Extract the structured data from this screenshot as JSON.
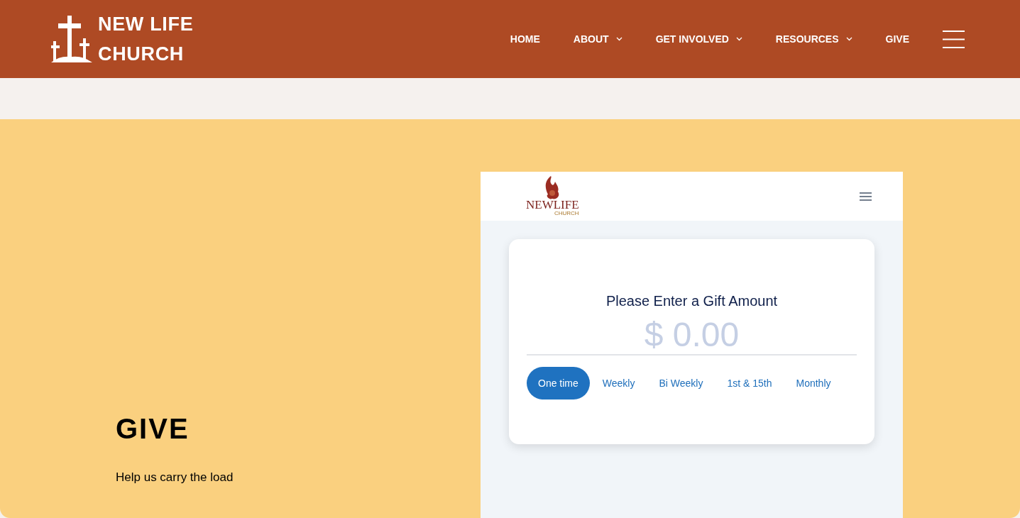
{
  "header": {
    "logo": {
      "line1": "NEW LIFE",
      "line2": "CHURCH"
    },
    "nav": [
      {
        "label": "HOME",
        "dropdown": false
      },
      {
        "label": "ABOUT",
        "dropdown": true
      },
      {
        "label": "GET INVOLVED",
        "dropdown": true
      },
      {
        "label": "RESOURCES",
        "dropdown": true
      },
      {
        "label": "GIVE",
        "dropdown": false
      }
    ]
  },
  "give_section": {
    "title": "GIVE",
    "subtitle": "Help us carry the load"
  },
  "giving_widget": {
    "logo": {
      "name": "NEWLIFE",
      "tagline": "CHURCH"
    },
    "card": {
      "heading": "Please Enter a Gift Amount",
      "amount_placeholder": "$ 0.00",
      "frequencies": [
        {
          "label": "One time",
          "selected": true
        },
        {
          "label": "Weekly",
          "selected": false
        },
        {
          "label": "Bi Weekly",
          "selected": false
        },
        {
          "label": "1st & 15th",
          "selected": false
        },
        {
          "label": "Monthly",
          "selected": false
        }
      ]
    }
  }
}
